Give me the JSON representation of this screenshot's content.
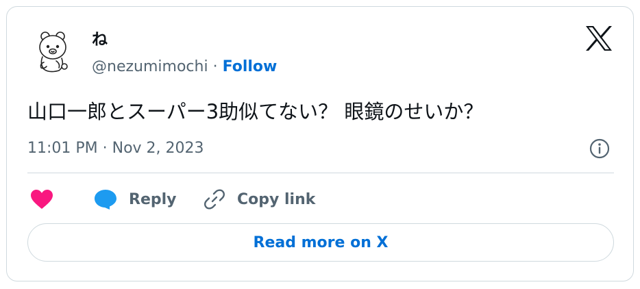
{
  "author": {
    "display_name": "ね",
    "handle": "@nezumimochi",
    "separator": "·",
    "follow_label": "Follow",
    "avatar_icon": "bear-avatar-icon"
  },
  "brand": {
    "logo_icon": "x-logo-icon"
  },
  "tweet": {
    "text": "山口一郎とスーパー3助似てない？ 眼鏡のせいか？",
    "timestamp": "11:01 PM · Nov 2, 2023"
  },
  "actions": {
    "like_icon": "heart-icon",
    "like_color": "#f91880",
    "reply_label": "Reply",
    "reply_icon": "speech-bubble-icon",
    "reply_color": "#1d9bf0",
    "copy_label": "Copy link",
    "copy_icon": "link-icon"
  },
  "footer": {
    "read_more_label": "Read more on X"
  },
  "colors": {
    "link_blue": "#006fd6",
    "secondary_text": "#536471",
    "border": "#cfd9de"
  }
}
